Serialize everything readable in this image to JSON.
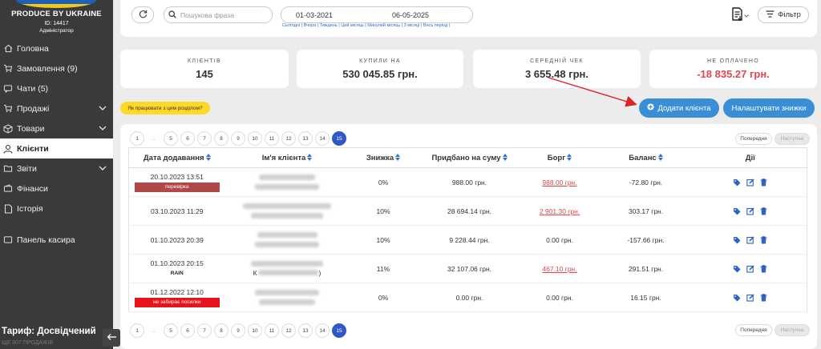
{
  "brand": {
    "name": "PRODUCE BY UKRAINE",
    "id": "ID: 14417",
    "role": "Адміністратор"
  },
  "sidebar": {
    "items": [
      {
        "label": "Головна",
        "icon": "home-icon"
      },
      {
        "label": "Замовлення (9)",
        "icon": "cart-icon"
      },
      {
        "label": "Чати (5)",
        "icon": "chat-icon"
      },
      {
        "label": "Продажі",
        "icon": "cart-icon"
      },
      {
        "label": "Товари",
        "icon": "box-icon"
      },
      {
        "label": "Клієнти",
        "icon": "user-icon"
      },
      {
        "label": "Звіти",
        "icon": "folder-icon"
      },
      {
        "label": "Фінанси",
        "icon": "wallet-icon"
      },
      {
        "label": "Історія",
        "icon": "document-icon"
      },
      {
        "label": "Панель касира",
        "icon": "cash-register-icon"
      }
    ],
    "tariff": "Тариф: Досвідчений",
    "tariff_sub": "ЩЕ 907 ПРОДАЖІВ"
  },
  "filters": {
    "search_placeholder": "Пошукова фраза",
    "date_from": "01-03-2021",
    "date_to": "06-05-2025",
    "quick_links": [
      "Сьогодні",
      "Вчора",
      "Тиждень",
      "Цей місяць",
      "Минулий місяць",
      "3 місяці",
      "Весь період"
    ],
    "filter_label": "Фільтр"
  },
  "stats": [
    {
      "label": "клієнтів",
      "value": "145"
    },
    {
      "label": "купили на",
      "value": "530 045.85 грн."
    },
    {
      "label": "середній чек",
      "value": "3 655.48 грн."
    },
    {
      "label": "не оплачено",
      "value": "-18 835.27 грн."
    }
  ],
  "help_text": "Як працювати з цим розділом?",
  "buttons": {
    "add_client": "Додати клієнта",
    "setup_discounts": "Налаштувати знижки"
  },
  "pagination": {
    "pages": [
      "1",
      "...",
      "5",
      "6",
      "7",
      "8",
      "9",
      "10",
      "11",
      "12",
      "13",
      "14",
      "15"
    ],
    "current": "15",
    "prev": "Попередня",
    "next": "Наступна"
  },
  "table": {
    "headers": [
      "Дата додавання",
      "Ім'я клієнта",
      "Знижка",
      "Придбано на суму",
      "Борг",
      "Баланс",
      "Дії"
    ],
    "rows": [
      {
        "date": "20.10.2023 13:51",
        "tag": "перевірка",
        "discount": "0%",
        "purchased": "988.00 грн.",
        "debt": "988.00 грн.",
        "balance": "-72.80 грн."
      },
      {
        "date": "03.10.2023 11:29",
        "tag": "",
        "discount": "10%",
        "purchased": "28 694.14 грн.",
        "debt": "2 901.30 грн.",
        "balance": "303.17 грн."
      },
      {
        "date": "01.10.2023 20:39",
        "tag": "",
        "discount": "10%",
        "purchased": "9 228.44 грн.",
        "debt": "0.00 грн.",
        "balance": "-157.66 грн."
      },
      {
        "date": "01.10.2023 20:15",
        "tag": "RAIN",
        "name_extra_start": "К",
        "name_extra_end": ")",
        "discount": "11%",
        "purchased": "32 107.06 грн.",
        "debt": "467.10 грн.",
        "balance": "291.51 грн."
      },
      {
        "date": "01.12.2022 12:10",
        "tag": "не забирає посилки",
        "discount": "0%",
        "purchased": "0.00 грн.",
        "debt": "0.00 грн.",
        "balance": "16.15 грн."
      }
    ]
  },
  "colors": {
    "primary": "#3a8ed6",
    "danger": "#e5434c",
    "sidebar": "#3a3a3a",
    "page_current": "#3457c8",
    "help": "#ffd829"
  }
}
